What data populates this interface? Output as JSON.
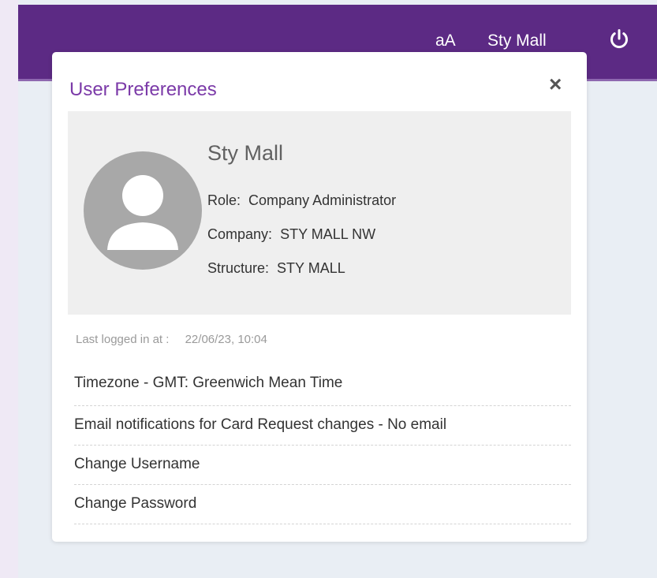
{
  "header": {
    "font_size_toggle": "aA",
    "user_name": "Sty Mall",
    "icons": {
      "power": "power-icon"
    },
    "colors": {
      "bar": "#5c2a84",
      "accent_line": "#8e68b0"
    }
  },
  "dialog": {
    "title": "User Preferences",
    "close_label": "×",
    "profile": {
      "name": "Sty Mall",
      "role_label": "Role:",
      "role_value": "Company Administrator",
      "company_label": "Company:",
      "company_value": "STY MALL NW",
      "structure_label": "Structure:",
      "structure_value": "STY MALL",
      "avatar_icon": "user-avatar-icon"
    },
    "last_login_label": "Last logged in at :",
    "last_login_value": "22/06/23, 10:04",
    "items": [
      {
        "label": "Timezone - GMT: Greenwich Mean Time"
      },
      {
        "label": "Email notifications for Card Request changes - No email"
      },
      {
        "label": "Change Username"
      },
      {
        "label": "Change Password"
      }
    ],
    "colors": {
      "title": "#7b3aa8",
      "card_bg": "#efefef"
    }
  }
}
